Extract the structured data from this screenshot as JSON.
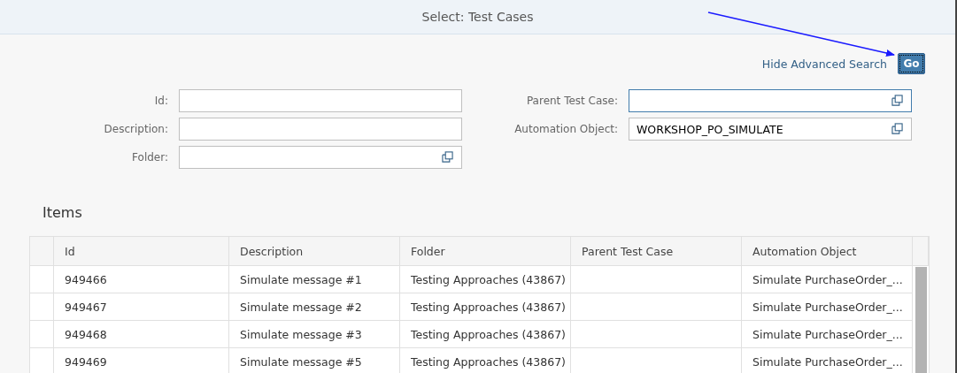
{
  "dialog": {
    "title": "Select: Test Cases"
  },
  "toolbar": {
    "link": "Hide Advanced Search",
    "go_button": "Go"
  },
  "filters": [
    [
      {
        "label": "Id:",
        "value_help": false,
        "focused": false
      },
      {
        "label": "Description:",
        "value_help": false,
        "focused": false
      },
      {
        "label": "Folder:",
        "value_help": true,
        "focused": false
      }
    ],
    [
      {
        "label": "Parent Test Case:",
        "value_help": true,
        "focused": true
      },
      {
        "label": "Automation Object:",
        "value": "WORKSHOP_PO_SIMULATE",
        "value_help": true,
        "focused": false
      }
    ]
  ],
  "table": {
    "title": "Items",
    "columns": [
      "Id",
      "Description",
      "Folder",
      "Parent Test Case",
      "Automation Object"
    ],
    "rows": [
      [
        "949466",
        "Simulate message #1",
        "Testing Approaches (43867)",
        "",
        "Simulate PurchaseOrder_..."
      ],
      [
        "949467",
        "Simulate message #2",
        "Testing Approaches (43867)",
        "",
        "Simulate PurchaseOrder_..."
      ],
      [
        "949468",
        "Simulate message #3",
        "Testing Approaches (43867)",
        "",
        "Simulate PurchaseOrder_..."
      ],
      [
        "949469",
        "Simulate message #5",
        "Testing Approaches (43867)",
        "",
        "Simulate PurchaseOrder_..."
      ]
    ]
  }
}
